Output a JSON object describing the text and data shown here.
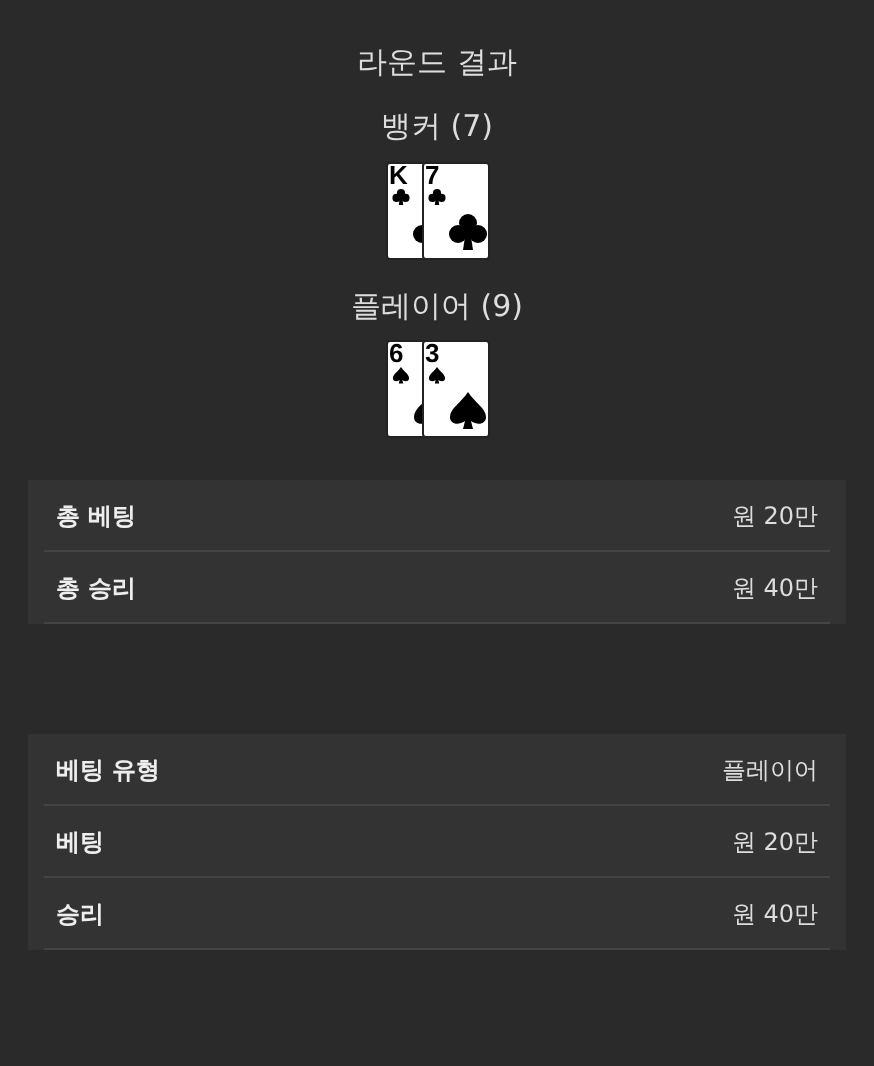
{
  "title": "라운드 결과",
  "hands": [
    {
      "label": "뱅커 (7)",
      "cards": [
        {
          "rank": "K",
          "kind": "clubs"
        },
        {
          "rank": "7",
          "kind": "clubs"
        }
      ]
    },
    {
      "label": "플레이어 (9)",
      "cards": [
        {
          "rank": "6",
          "kind": "spades"
        },
        {
          "rank": "3",
          "kind": "spades"
        }
      ]
    }
  ],
  "summary": [
    {
      "label": "총 베팅",
      "value": "원 20만"
    },
    {
      "label": "총 승리",
      "value": "원 40만"
    }
  ],
  "bet_details": [
    {
      "label": "베팅 유형",
      "value": "플레이어"
    },
    {
      "label": "베팅",
      "value": "원 20만"
    },
    {
      "label": "승리",
      "value": "원 40만"
    }
  ]
}
